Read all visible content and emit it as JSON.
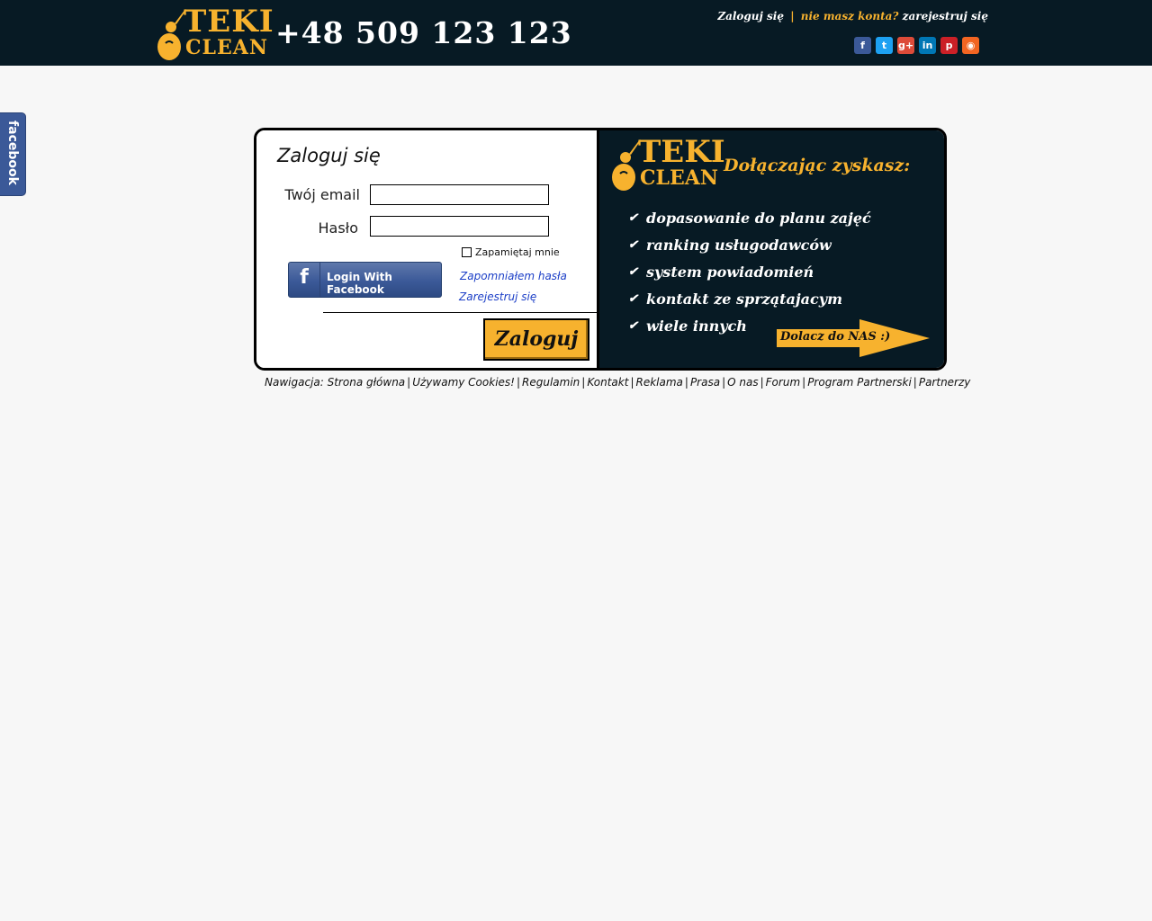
{
  "header": {
    "logo_top": "TEKI",
    "logo_bottom": "CLEAN",
    "phone": "+48 509 123 123",
    "login_link": "Zaloguj się",
    "separator": "|",
    "no_account": "nie masz konta?",
    "register_link": "zarejestruj się",
    "social": [
      {
        "icon": "facebook-icon",
        "glyph": "f",
        "color": "#3b5998"
      },
      {
        "icon": "twitter-icon",
        "glyph": "t",
        "color": "#1da1f2"
      },
      {
        "icon": "google-plus-icon",
        "glyph": "g+",
        "color": "#dd4b39"
      },
      {
        "icon": "linkedin-icon",
        "glyph": "in",
        "color": "#0077b5"
      },
      {
        "icon": "pinterest-icon",
        "glyph": "p",
        "color": "#cb2027"
      },
      {
        "icon": "rss-icon",
        "glyph": "◉",
        "color": "#f26522"
      }
    ]
  },
  "side_tab": {
    "label": "facebook"
  },
  "login": {
    "title": "Zaloguj się",
    "email_label": "Twój email",
    "email_value": "",
    "password_label": "Hasło",
    "password_value": "",
    "remember_label": "Zapamiętaj mnie",
    "remember_checked": false,
    "facebook_button": "Login With Facebook",
    "facebook_glyph": "f",
    "forgot_password": "Zapomniałem hasła",
    "register": "Zarejestruj się",
    "submit": "Zaloguj"
  },
  "promo": {
    "logo_top": "TEKI",
    "logo_bottom": "CLEAN",
    "title": "Dołączając zyskasz:",
    "check_glyph": "✔",
    "benefits": [
      "dopasowanie do planu zajęć",
      "ranking usługodawców",
      "system powiadomień",
      "kontakt ze sprzątajacym",
      "wiele innych"
    ],
    "join_button": "Dolacz do NAS :)"
  },
  "footer": {
    "prefix": "Nawigacja:",
    "links": [
      "Strona główna",
      "Używamy Cookies!",
      "Regulamin",
      "Kontakt",
      "Reklama",
      "Prasa",
      "O nas",
      "Forum",
      "Program Partnerski",
      "Partnerzy"
    ]
  },
  "colors": {
    "header_bg": "#071a24",
    "accent": "#f7b22e",
    "link": "#1c3fc7",
    "facebook": "#3b5998"
  }
}
